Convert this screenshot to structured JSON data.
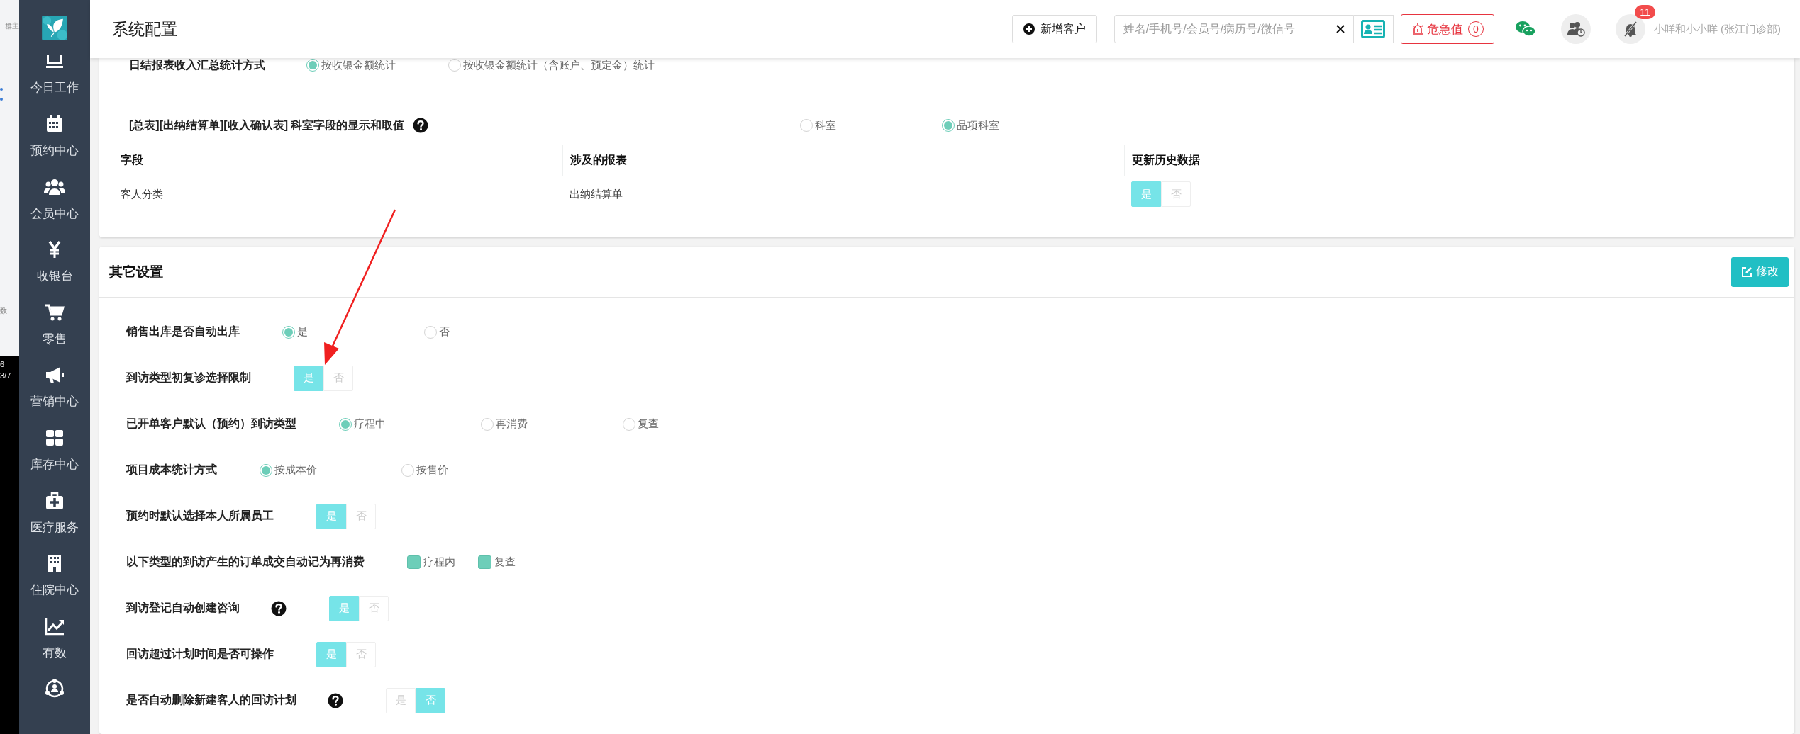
{
  "side_window": {
    "fragments": [
      "群主",
      "数",
      "6",
      "3/7"
    ]
  },
  "sidebar": {
    "items": [
      {
        "label": "今日工作"
      },
      {
        "label": "预约中心"
      },
      {
        "label": "会员中心"
      },
      {
        "label": "收银台"
      },
      {
        "label": "零售"
      },
      {
        "label": "营销中心"
      },
      {
        "label": "库存中心"
      },
      {
        "label": "医疗服务"
      },
      {
        "label": "住院中心"
      },
      {
        "label": "有数"
      }
    ]
  },
  "header": {
    "title": "系统配置",
    "new_customer_button": "新增客户",
    "search": {
      "placeholder": "姓名/手机号/会员号/病历号/微信号"
    },
    "alert_button": {
      "label": "危急值",
      "count": "0"
    },
    "notification_count": "11",
    "user": "小咩和小小咩 (张江门诊部)"
  },
  "report_settings": {
    "summary_row": {
      "label": "日结报表收入汇总统计方式",
      "options": [
        {
          "label": "按收银金额统计",
          "selected": true
        },
        {
          "label": "按收银金额统计（含账户、预定金）统计",
          "selected": false
        }
      ]
    },
    "department_row": {
      "label": "[总表][出纳结算单][收入确认表] 科室字段的显示和取值",
      "help": true,
      "options": [
        {
          "label": "科室",
          "selected": false
        },
        {
          "label": "品项科室",
          "selected": true
        }
      ]
    },
    "table": {
      "columns": [
        "字段",
        "涉及的报表",
        "更新历史数据"
      ],
      "rows": [
        {
          "field": "客人分类",
          "report": "出纳结算单",
          "update_history": [
            {
              "label": "是",
              "selected": true
            },
            {
              "label": "否",
              "selected": false
            }
          ]
        }
      ]
    }
  },
  "other_settings": {
    "title": "其它设置",
    "edit_button": "修改",
    "rows": [
      {
        "kind": "radio",
        "label": "销售出库是否自动出库",
        "help": false,
        "options": [
          {
            "label": "是",
            "selected": true
          },
          {
            "label": "否",
            "selected": false
          }
        ]
      },
      {
        "kind": "toggle",
        "label": "到访类型初复诊选择限制",
        "help": false,
        "options": [
          {
            "label": "是",
            "selected": true
          },
          {
            "label": "否",
            "selected": false
          }
        ]
      },
      {
        "kind": "radio",
        "label": "已开单客户默认（预约）到访类型",
        "help": false,
        "options": [
          {
            "label": "疗程中",
            "selected": true
          },
          {
            "label": "再消费",
            "selected": false
          },
          {
            "label": "复查",
            "selected": false
          }
        ]
      },
      {
        "kind": "radio",
        "label": "项目成本统计方式",
        "help": false,
        "options": [
          {
            "label": "按成本价",
            "selected": true
          },
          {
            "label": "按售价",
            "selected": false
          }
        ]
      },
      {
        "kind": "toggle",
        "label": "预约时默认选择本人所属员工",
        "help": false,
        "options": [
          {
            "label": "是",
            "selected": true
          },
          {
            "label": "否",
            "selected": false
          }
        ]
      },
      {
        "kind": "checkbox",
        "label": "以下类型的到访产生的订单成交自动记为再消费",
        "help": false,
        "options": [
          {
            "label": "疗程内",
            "checked": true
          },
          {
            "label": "复查",
            "checked": true
          }
        ]
      },
      {
        "kind": "toggle",
        "label": "到访登记自动创建咨询",
        "help": true,
        "options": [
          {
            "label": "是",
            "selected": true
          },
          {
            "label": "否",
            "selected": false
          }
        ]
      },
      {
        "kind": "toggle",
        "label": "回访超过计划时间是否可操作",
        "help": false,
        "options": [
          {
            "label": "是",
            "selected": true
          },
          {
            "label": "否",
            "selected": false
          }
        ]
      },
      {
        "kind": "toggle",
        "label": "是否自动删除新建客人的回访计划",
        "help": true,
        "options": [
          {
            "label": "是",
            "selected": false
          },
          {
            "label": "否",
            "selected": true
          }
        ]
      }
    ]
  }
}
